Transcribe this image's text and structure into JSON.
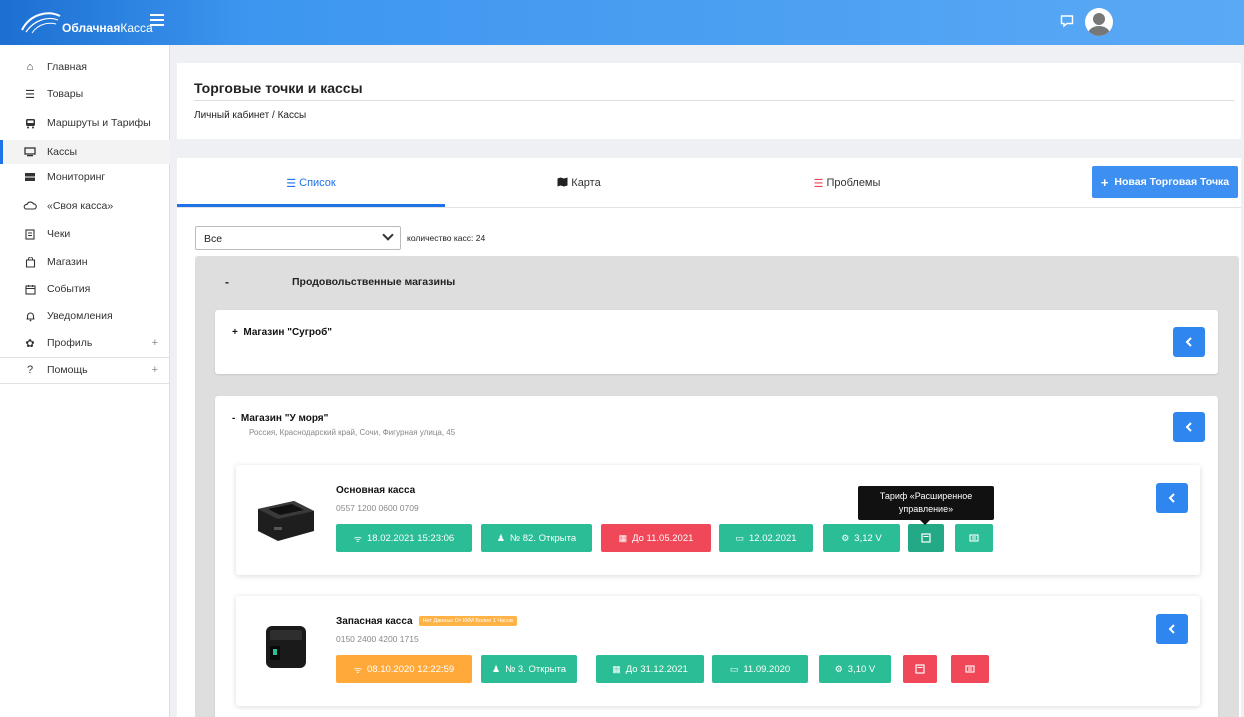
{
  "topbar": {
    "logo_bold": "Облачная",
    "logo_light": "Касса"
  },
  "sidebar": {
    "items": [
      {
        "label": "Главная",
        "icon": "home-icon"
      },
      {
        "label": "Товары",
        "icon": "list-icon"
      },
      {
        "label": "Маршруты и Тарифы",
        "icon": "bus-icon"
      },
      {
        "label": "Кассы",
        "icon": "monitor-icon"
      },
      {
        "label": "Мониторинг",
        "icon": "server-icon"
      },
      {
        "label": "«Своя касса»",
        "icon": "cloud-icon"
      },
      {
        "label": "Чеки",
        "icon": "receipt-icon"
      },
      {
        "label": "Магазин",
        "icon": "store-icon"
      },
      {
        "label": "События",
        "icon": "calendar-icon"
      },
      {
        "label": "Уведомления",
        "icon": "bell-icon"
      },
      {
        "label": "Профиль",
        "icon": "gear-icon",
        "plus": "+"
      },
      {
        "label": "Помощь",
        "icon": "question-icon",
        "plus": "+"
      }
    ]
  },
  "header": {
    "title": "Торговые точки и кассы",
    "breadcrumb": "Личный кабинет  /  Кассы"
  },
  "tabs": {
    "list": "Список",
    "map": "Карта",
    "problems": "Проблемы",
    "new_point": "Новая Торговая Точка"
  },
  "filter": {
    "selected": "Все",
    "count_label": "количество касс: 24"
  },
  "group": {
    "toggle": "-",
    "title": "Продовольственные магазины"
  },
  "shops": [
    {
      "toggle": "+",
      "title": "Магазин \"Сугроб\""
    },
    {
      "toggle": "-",
      "title": "Магазин \"У моря\"",
      "address": "Россия, Краснодарский край, Сочи, Фигурная улица, 45"
    }
  ],
  "kassas": [
    {
      "name": "Основная касса",
      "serial": "0557 1200 0600 0709",
      "buttons": {
        "last_seen": "18.02.2021 15:23:06",
        "shift": "№ 82. Открыта",
        "fn_until": "До 11.05.2021",
        "reg_date": "12.02.2021",
        "voltage": "3,12 V"
      }
    },
    {
      "name": "Запасная касса",
      "badge": "Нет Данных От ККМ Более 1 Часов",
      "serial": "0150 2400 4200 1715",
      "buttons": {
        "last_seen": "08.10.2020 12:22:59",
        "shift": "№ 3. Открыта",
        "fn_until": "До 31.12.2021",
        "reg_date": "11.09.2020",
        "voltage": "3,10 V"
      }
    }
  ],
  "tooltip": {
    "line1": "Тариф «Расширенное",
    "line2": "управление»"
  },
  "colors": {
    "accent": "#1e73e8",
    "teal": "#2bbd95",
    "red": "#f04858",
    "orange": "#ffa93a"
  }
}
